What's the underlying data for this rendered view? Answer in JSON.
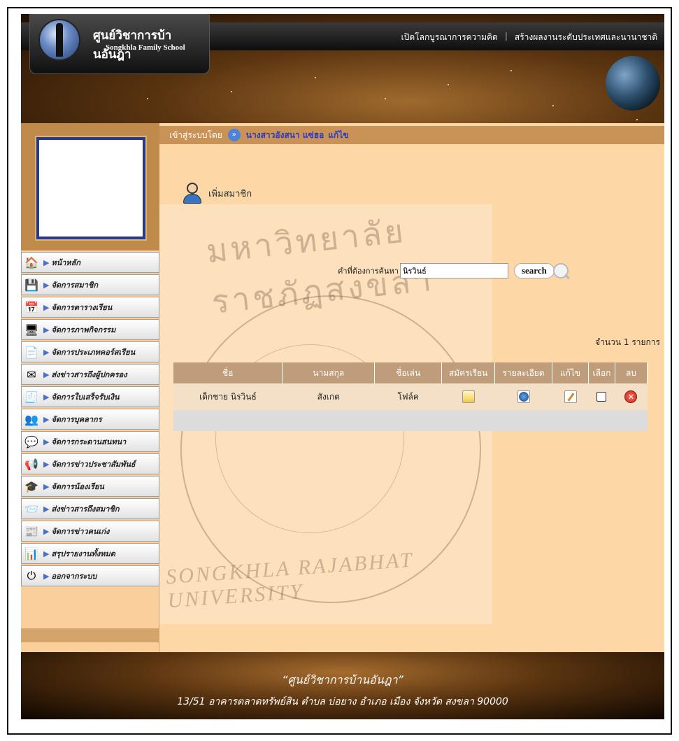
{
  "header": {
    "school_name": "ศูนย์วิชาการบ้านอันฎา",
    "school_name_en": "Songkhla Family School",
    "top_links": [
      "เปิดโลกบูรณาการความคิด",
      "สร้างผลงานระดับประเทศและนานาชาติ"
    ]
  },
  "login": {
    "label": "เข้าสู่ระบบโดย",
    "user": "นางสาวอังสนา แซ่ฮอ",
    "edit_link": "แก้ไข"
  },
  "sidebar": {
    "items": [
      {
        "label": "หน้าหลัก",
        "icon": "home-icon"
      },
      {
        "label": "จัดการสมาชิก",
        "icon": "member-icon"
      },
      {
        "label": "จัดการตารางเรียน",
        "icon": "schedule-icon"
      },
      {
        "label": "จัดการภาพกิจกรรม",
        "icon": "activity-photo-icon"
      },
      {
        "label": "จัดการประเภทคอร์สเรียน",
        "icon": "course-type-icon"
      },
      {
        "label": "ส่งข่าวสารถึงผู้ปกครอง",
        "icon": "parent-news-icon"
      },
      {
        "label": "จัดการใบเสร็จรับเงิน",
        "icon": "receipt-icon"
      },
      {
        "label": "จัดการบุคลากร",
        "icon": "staff-icon"
      },
      {
        "label": "จัดการกระดานสนทนา",
        "icon": "forum-icon"
      },
      {
        "label": "จัดการข่าวประชาสัมพันธ์",
        "icon": "pr-news-icon"
      },
      {
        "label": "จัดการน้องเรียน",
        "icon": "student-icon"
      },
      {
        "label": "ส่งข่าวสารถึงสมาชิก",
        "icon": "member-news-icon"
      },
      {
        "label": "จัดการข่าวคนเก่ง",
        "icon": "talent-news-icon"
      },
      {
        "label": "สรุปรายงานทั้งหมด",
        "icon": "report-icon"
      },
      {
        "label": "ออกจากระบบ",
        "icon": "logout-icon"
      }
    ]
  },
  "main": {
    "add_member": "เพิ่มสมาชิก",
    "search": {
      "label": "คำที่ต้องการค้นหา",
      "value": "นิรวินธ์",
      "button": "search"
    },
    "count_text": "จำนวน 1 รายการ",
    "table": {
      "headers": [
        "ชื่อ",
        "นามสกุล",
        "ชื่อเล่น",
        "สมัครเรียน",
        "รายละเอียด",
        "แก้ไข",
        "เลือก",
        "ลบ"
      ],
      "rows": [
        {
          "first_name": "เด็กชาย นิรวินธ์",
          "last_name": "สังเกต",
          "nickname": "โฟล์ค"
        }
      ]
    }
  },
  "watermark": {
    "top_text": "มหาวิทยาลัยราชภัฏสงขลา",
    "bottom_text": "SONGKHLA RAJABHAT UNIVERSITY"
  },
  "footer": {
    "line1": "“ศูนย์วิชาการบ้านอันฎา”",
    "line2": "13/51 อาคารตลาดทรัพย์สิน ตำบล บ่อยาง อำเภอ เมือง จังหวัด สงขลา 90000"
  }
}
